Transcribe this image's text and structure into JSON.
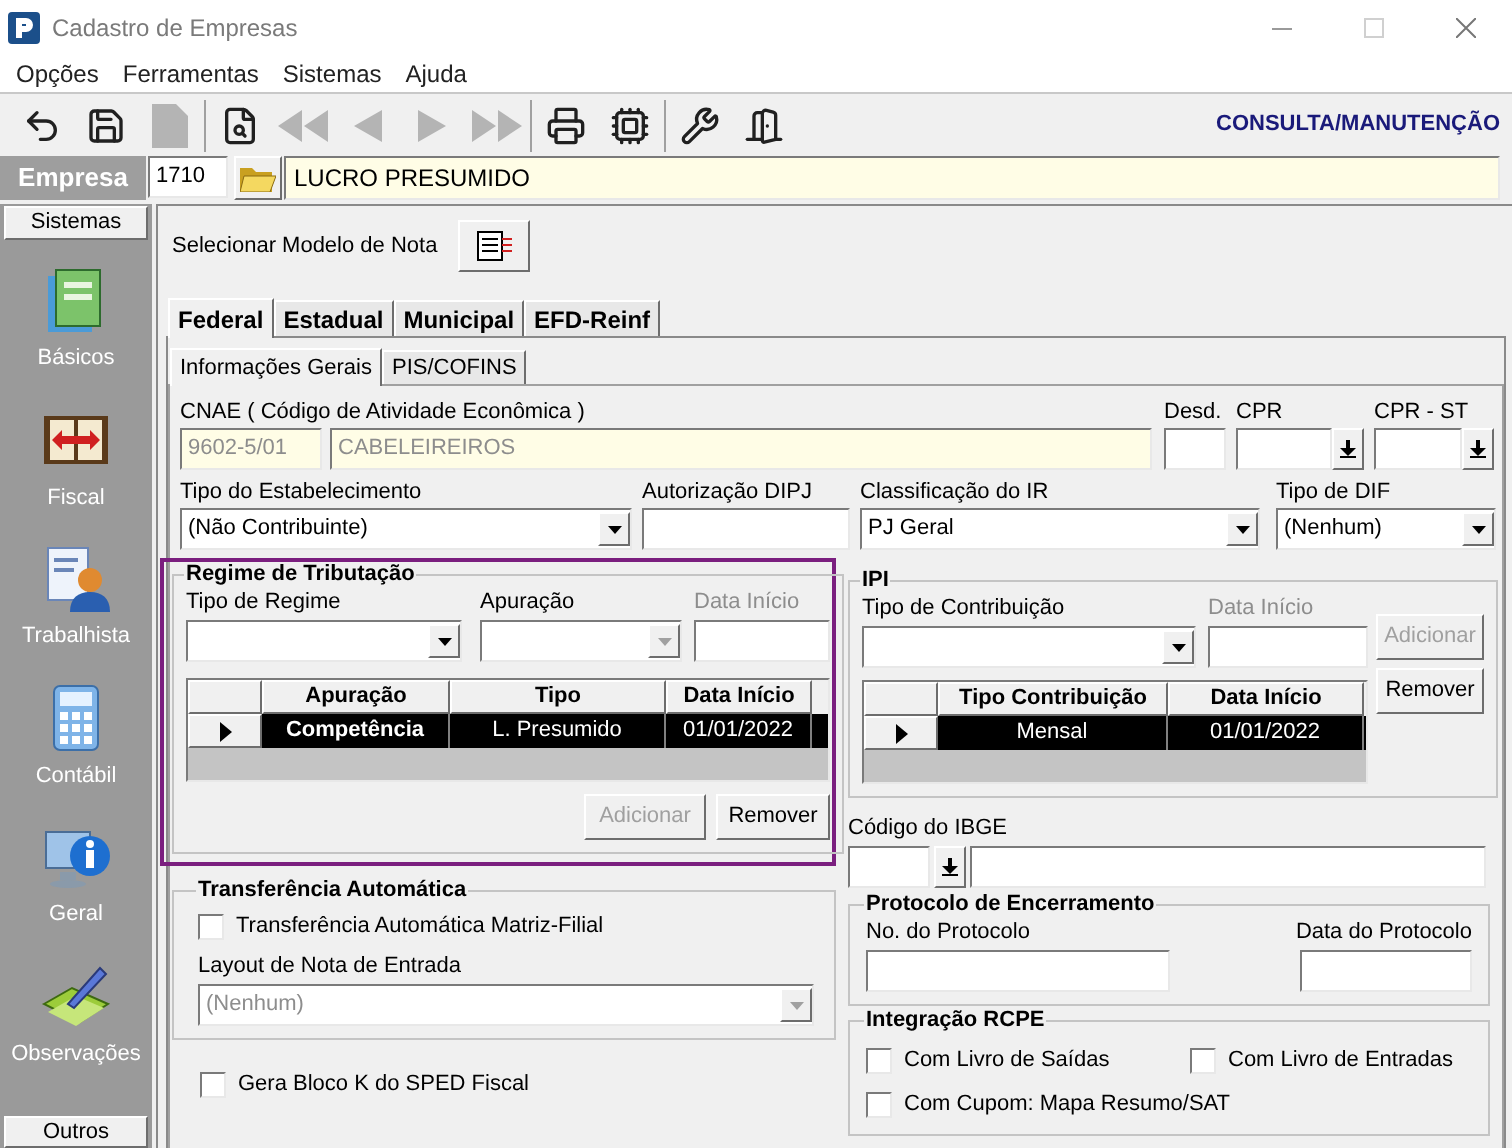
{
  "window": {
    "title": "Cadastro de Empresas"
  },
  "menu": [
    "Opções",
    "Ferramentas",
    "Sistemas",
    "Ajuda"
  ],
  "toolbar": {
    "groups": [
      [
        {
          "kind": "undo",
          "disabled": false
        },
        {
          "kind": "save",
          "disabled": false
        },
        {
          "kind": "document",
          "disabled": true
        }
      ],
      [
        {
          "kind": "preview",
          "disabled": false
        },
        {
          "kind": "first",
          "disabled": true
        },
        {
          "kind": "prev",
          "disabled": true
        },
        {
          "kind": "next",
          "disabled": true
        },
        {
          "kind": "last",
          "disabled": true
        }
      ],
      [
        {
          "kind": "print",
          "disabled": false
        },
        {
          "kind": "machine",
          "disabled": false
        }
      ],
      [
        {
          "kind": "tools",
          "disabled": false
        },
        {
          "kind": "exit",
          "disabled": false
        }
      ]
    ],
    "mode": "CONSULTA/MANUTENÇÃO"
  },
  "empresa": {
    "label": "Empresa",
    "code": "1710",
    "name": "LUCRO PRESUMIDO"
  },
  "sidebar": {
    "header": "Sistemas",
    "items": [
      {
        "kind": "books",
        "label": "Básicos"
      },
      {
        "kind": "book",
        "label": "Fiscal"
      },
      {
        "kind": "person",
        "label": "Trabalhista"
      },
      {
        "kind": "calculator",
        "label": "Contábil"
      },
      {
        "kind": "info",
        "label": "Geral"
      },
      {
        "kind": "notes",
        "label": "Observações"
      }
    ],
    "footer": "Outros"
  },
  "modelo_nota": {
    "label": "Selecionar Modelo de Nota"
  },
  "tabs": [
    {
      "label": "Federal",
      "selected": true
    },
    {
      "label": "Estadual",
      "selected": false
    },
    {
      "label": "Municipal",
      "selected": false
    },
    {
      "label": "EFD-Reinf",
      "selected": false
    }
  ],
  "subtabs": [
    {
      "label": "Informações Gerais",
      "selected": true
    },
    {
      "label": "PIS/COFINS",
      "selected": false
    }
  ],
  "cnae": {
    "label": "CNAE ( Código de  Atividade Econômica )",
    "code": "9602-5/01",
    "description": "CABELEIREIROS"
  },
  "desd": {
    "label": "Desd."
  },
  "cpr": {
    "label": "CPR"
  },
  "cpr_st": {
    "label": "CPR - ST"
  },
  "tipo_estabelecimento": {
    "label": "Tipo do Estabelecimento",
    "value": "(Não Contribuinte)"
  },
  "autorizacao_dipj": {
    "label": "Autorização DIPJ"
  },
  "classificacao_ir": {
    "label": "Classificação do IR",
    "value": "PJ Geral"
  },
  "tipo_dif": {
    "label": "Tipo de DIF",
    "value": "(Nenhum)"
  },
  "regime": {
    "title": "Regime de Tributação",
    "tipo_regime": {
      "label": "Tipo de Regime",
      "disabled": false
    },
    "apuracao": {
      "label": "Apuração",
      "disabled": true
    },
    "data_inicio": {
      "label": "Data Início",
      "disabled": true
    },
    "table": {
      "columns": [
        "Apuração",
        "Tipo",
        "Data Início"
      ],
      "rows": [
        {
          "cells": [
            "Competência",
            "L. Presumido",
            "01/01/2022"
          ],
          "selected": true
        }
      ]
    },
    "buttons": [
      {
        "label": "Adicionar",
        "disabled": true
      },
      {
        "label": "Remover",
        "disabled": false
      }
    ]
  },
  "ipi": {
    "title": "IPI",
    "tipo_contribuicao": {
      "label": "Tipo de Contribuição",
      "disabled": false
    },
    "data_inicio": {
      "label": "Data Início",
      "disabled": true
    },
    "table": {
      "columns": [
        "Tipo Contribuição",
        "Data Início"
      ],
      "rows": [
        {
          "cells": [
            "Mensal",
            "01/01/2022"
          ],
          "selected": true
        }
      ]
    },
    "buttons": [
      {
        "label": "Adicionar",
        "disabled": true
      },
      {
        "label": "Remover",
        "disabled": false
      }
    ]
  },
  "codigo_ibge": {
    "label": "Código do IBGE"
  },
  "transferencia": {
    "title": "Transferência Automática",
    "checkbox": {
      "label": "Transferência Automática Matriz-Filial",
      "checked": false
    },
    "layout": {
      "label": "Layout de Nota de Entrada",
      "value": "(Nenhum)",
      "disabled": true
    }
  },
  "gera_bloco_k": {
    "label": "Gera Bloco K do SPED Fiscal",
    "checked": false
  },
  "protocolo": {
    "title": "Protocolo de Encerramento",
    "numero": {
      "label": "No. do Protocolo"
    },
    "data": {
      "label": "Data do Protocolo"
    }
  },
  "rcpe": {
    "title": "Integração RCPE",
    "options": [
      {
        "label": "Com Livro de Saídas",
        "checked": false
      },
      {
        "label": "Com Livro de Entradas",
        "checked": false
      },
      {
        "label": "Com Cupom: Mapa Resumo/SAT",
        "checked": false
      }
    ]
  }
}
